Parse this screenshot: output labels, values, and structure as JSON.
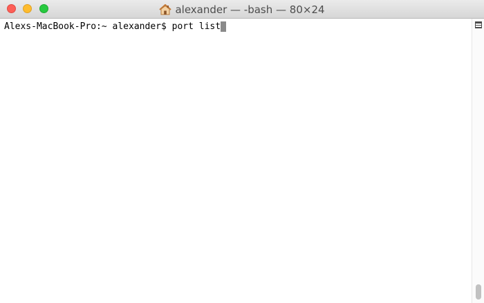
{
  "window": {
    "title": "alexander — -bash — 80×24",
    "icons": {
      "title_icon": "home-icon",
      "split_pane": "split-pane-icon"
    },
    "colors": {
      "close": "#fd5f57",
      "minimize": "#febc2e",
      "zoom": "#27c93f"
    }
  },
  "terminal": {
    "prompt": "Alexs-MacBook-Pro:~ alexander$ ",
    "command": "port list"
  }
}
